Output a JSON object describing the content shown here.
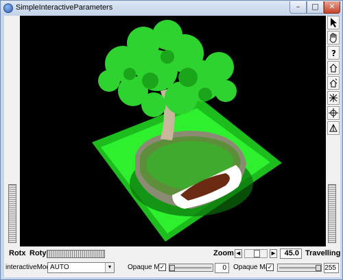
{
  "window": {
    "title": "SimpleInteractiveParameters",
    "controls": {
      "minimize": "–",
      "maximize": "□",
      "close": "✕"
    }
  },
  "toolbar_icons": [
    "select-arrow-icon",
    "hand-view-icon",
    "help-icon",
    "home-icon",
    "set-home-icon",
    "view-all-icon",
    "seek-icon",
    "projection-icon"
  ],
  "bottom_bar": {
    "rotx_label": "Rotx",
    "roty_label": "Roty",
    "zoom_label": "Zoom",
    "zoom_left": "◀",
    "zoom_right": "▶",
    "zoom_value": "45.0",
    "travelling_label": "Travelling"
  },
  "params": {
    "interactive_mode_label": "interactiveMode",
    "interactive_mode_value": "AUTO",
    "opaque_min_label": "Opaque Min",
    "opaque_min_checked": "✓",
    "opaque_min_value": "0",
    "opaque_min_fraction": 0.0,
    "opaque_max_label": "Opaque Max",
    "opaque_max_checked": "✓",
    "opaque_max_value": "255",
    "opaque_max_fraction": 1.0
  },
  "colors": {
    "accent_green": "#22ff22",
    "viewer_bg": "#000000"
  }
}
